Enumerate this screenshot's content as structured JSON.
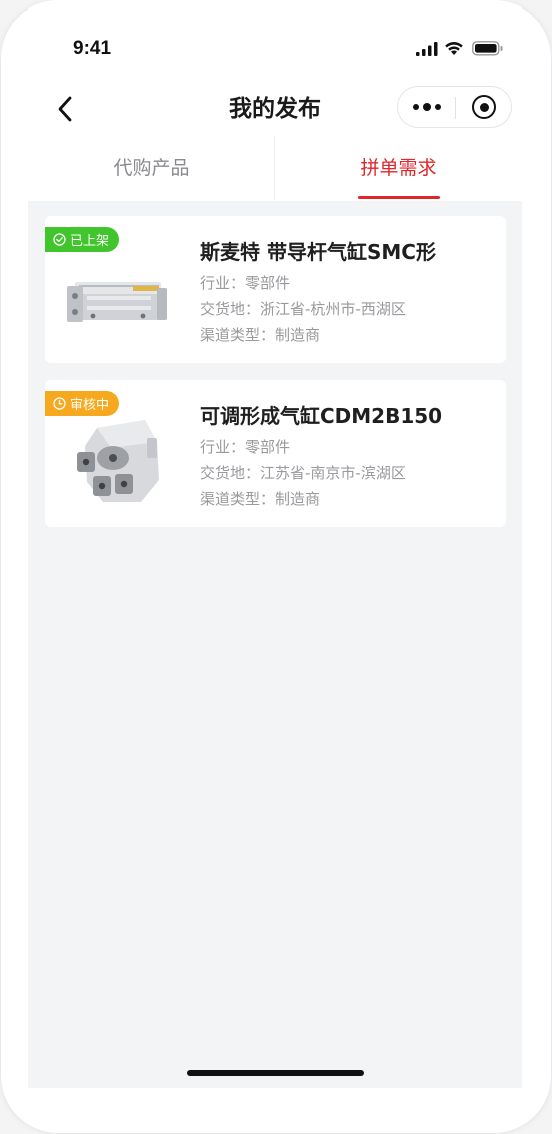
{
  "status_bar": {
    "time": "9:41"
  },
  "nav": {
    "title": "我的发布"
  },
  "tabs": [
    {
      "label": "代购产品",
      "active": false
    },
    {
      "label": "拼单需求",
      "active": true
    }
  ],
  "listings": [
    {
      "status": "已上架",
      "status_color": "#41c52d",
      "title": "斯麦特 带导杆气缸SMC形",
      "industry": "行业：零部件",
      "delivery": "交货地：浙江省-杭州市-西湖区",
      "channel": "渠道类型：制造商"
    },
    {
      "status": "审核中",
      "status_color": "#f6a81e",
      "title": "可调形成气缸CDM2B150",
      "industry": "行业：零部件",
      "delivery": "交货地：江苏省-南京市-滨湖区",
      "channel": "渠道类型：制造商"
    }
  ],
  "colors": {
    "accent": "#e0262b",
    "background": "#f3f4f6"
  }
}
